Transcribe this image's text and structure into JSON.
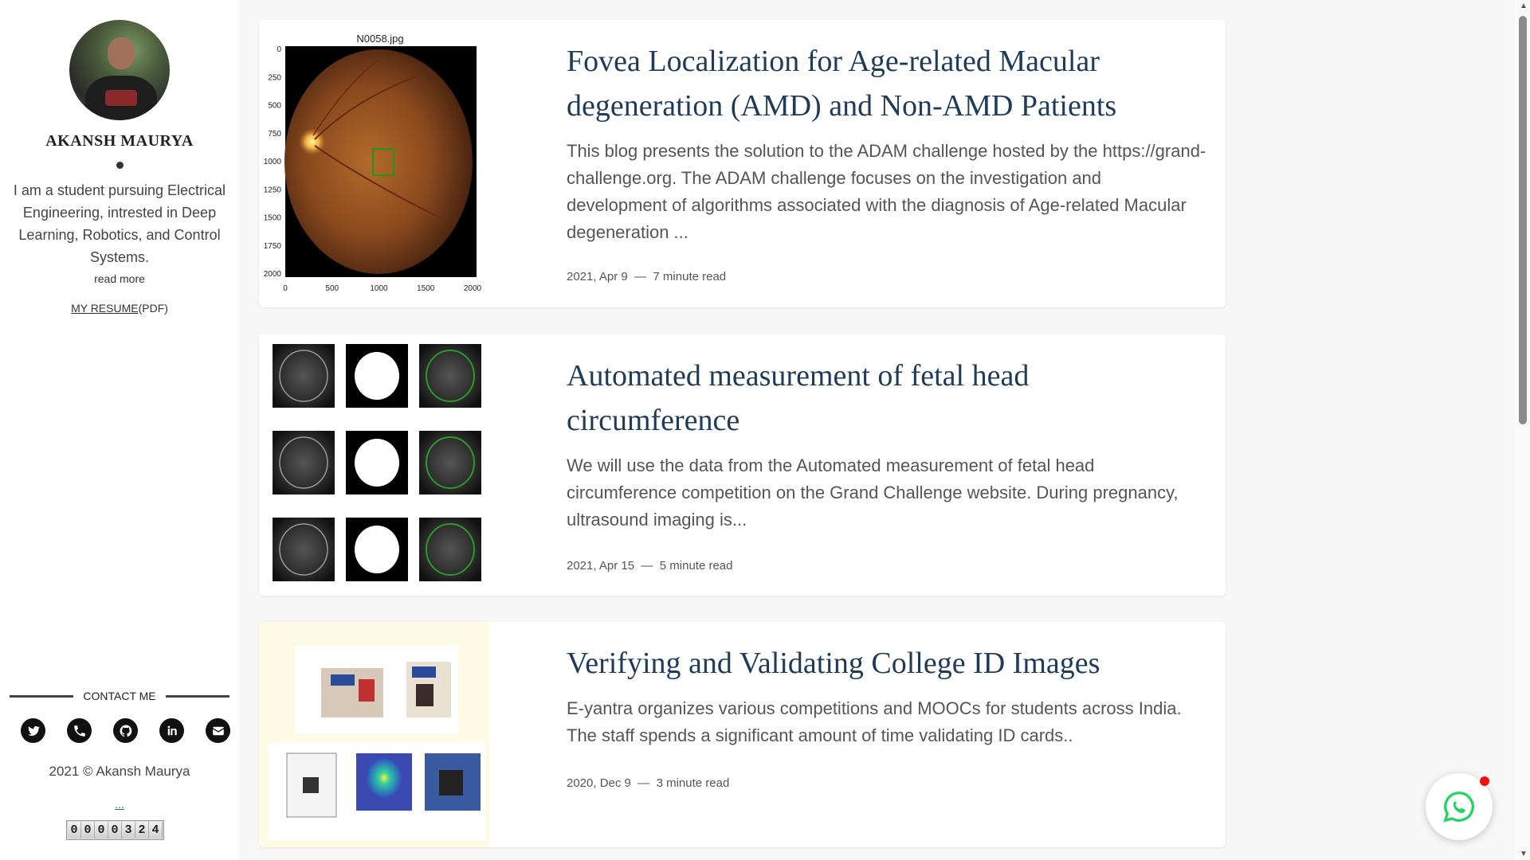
{
  "sidebar": {
    "name": "AKANSH MAURYA",
    "bio": "I am a student pursuing Electrical Engineering, intrested in Deep Learning, Robotics, and Control Systems.",
    "read_more": "read more",
    "resume_link": "MY RESUME",
    "resume_suffix": "(PDF)",
    "contact_heading": "CONTACT ME",
    "socials": [
      "twitter-icon",
      "phone-icon",
      "github-icon",
      "linkedin-icon",
      "email-icon"
    ],
    "copyright": "2021 © Akansh Maurya",
    "dots_link": "...",
    "counter": [
      "0",
      "0",
      "0",
      "0",
      "3",
      "2",
      "4"
    ]
  },
  "posts": [
    {
      "title": "Fovea Localization for Age-related Macular degeneration (AMD) and Non-AMD Patients",
      "description": "This blog presents the solution to the ADAM challenge hosted by the https://grand-challenge.org. The ADAM challenge focuses on the investigation and development of algorithms associated with the diagnosis of Age-related Macular degeneration ...",
      "date": "2021, Apr 9",
      "separator": "—",
      "read_time": "7 minute read",
      "thumb_title": "N0058.jpg",
      "thumb_yticks": [
        "0",
        "250",
        "500",
        "750",
        "1000",
        "1250",
        "1500",
        "1750",
        "2000"
      ],
      "thumb_xticks": [
        "0",
        "500",
        "1000",
        "1500",
        "2000"
      ]
    },
    {
      "title": "Automated measurement of fetal head circumference",
      "description": "We will use the data from the Automated measurement of fetal head circumference competition on the Grand Challenge website. During pregnancy, ultrasound imaging is...",
      "date": "2021, Apr 15",
      "separator": "—",
      "read_time": "5 minute read"
    },
    {
      "title": "Verifying and Validating College ID Images",
      "description": "E-yantra organizes various competitions and MOOCs for students across India. The staff spends a significant amount of time validating ID cards..",
      "date": "2020, Dec 9",
      "separator": "—",
      "read_time": "3 minute read"
    }
  ],
  "colors": {
    "title": "#1f3b5a",
    "whatsapp": "#25d366",
    "badge": "#ee1111"
  }
}
